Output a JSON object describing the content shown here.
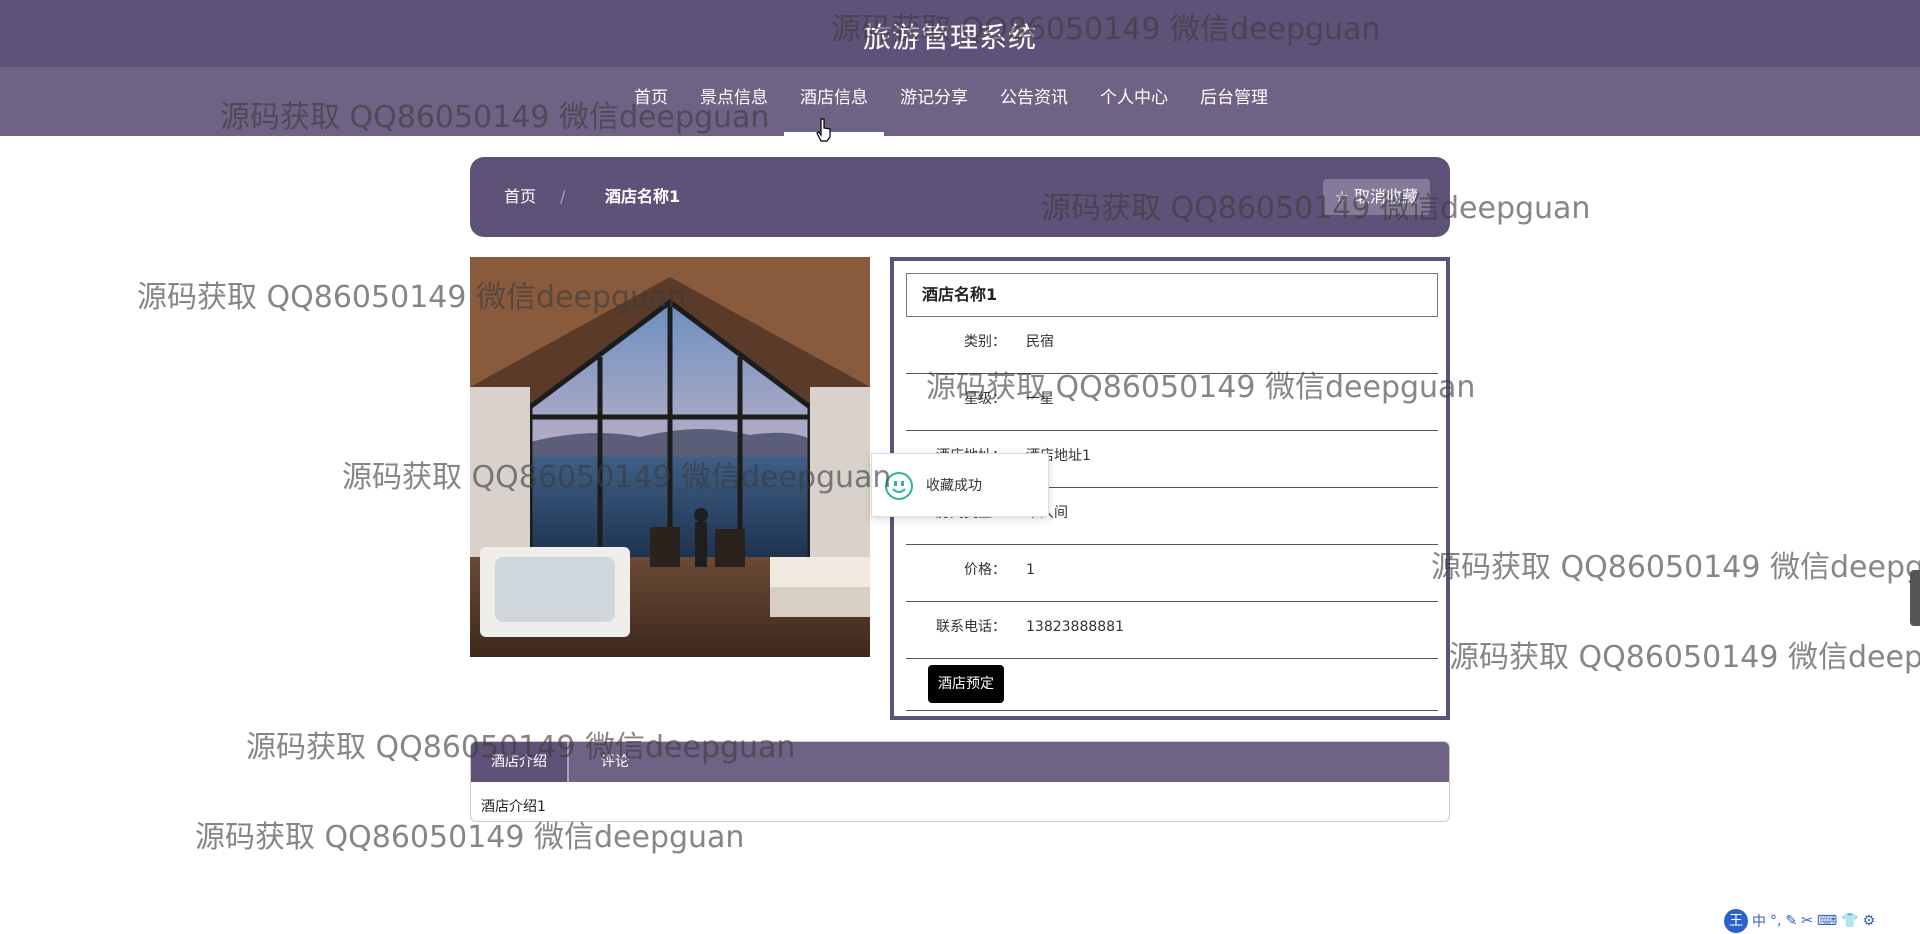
{
  "header": {
    "title": "旅游管理系统"
  },
  "nav": {
    "items": [
      {
        "label": "首页"
      },
      {
        "label": "景点信息"
      },
      {
        "label": "酒店信息"
      },
      {
        "label": "游记分享"
      },
      {
        "label": "公告资讯"
      },
      {
        "label": "个人中心"
      },
      {
        "label": "后台管理"
      }
    ],
    "active_index": 2
  },
  "breadcrumb": {
    "home": "首页",
    "separator": "/",
    "current": "酒店名称1",
    "favorite_label": "☆ 取消收藏"
  },
  "hotel": {
    "name": "酒店名称1",
    "fields": [
      {
        "label": "类别：",
        "value": "民宿"
      },
      {
        "label": "星级：",
        "value": "一星"
      },
      {
        "label": "酒店地址：",
        "value": "酒店地址1"
      },
      {
        "label": "房间类型：",
        "value": "单人间"
      },
      {
        "label": "价格：",
        "value": "1"
      },
      {
        "label": "联系电话：",
        "value": "13823888881"
      }
    ],
    "book_label": "酒店预定"
  },
  "toast": {
    "message": "收藏成功"
  },
  "tabs": {
    "items": [
      {
        "label": "酒店介绍"
      },
      {
        "label": "评论"
      }
    ],
    "content": "酒店介绍1"
  },
  "watermark": {
    "text": "源码获取 QQ86050149 微信deepguan"
  },
  "tray": {
    "logo": "王",
    "items": [
      "中",
      "°,",
      "✎",
      "✂",
      "⌨",
      "👕",
      "⚙"
    ]
  },
  "colors": {
    "primary": "#5f5278",
    "nav": "#6f6385",
    "toast_icon": "#2fb39b"
  }
}
